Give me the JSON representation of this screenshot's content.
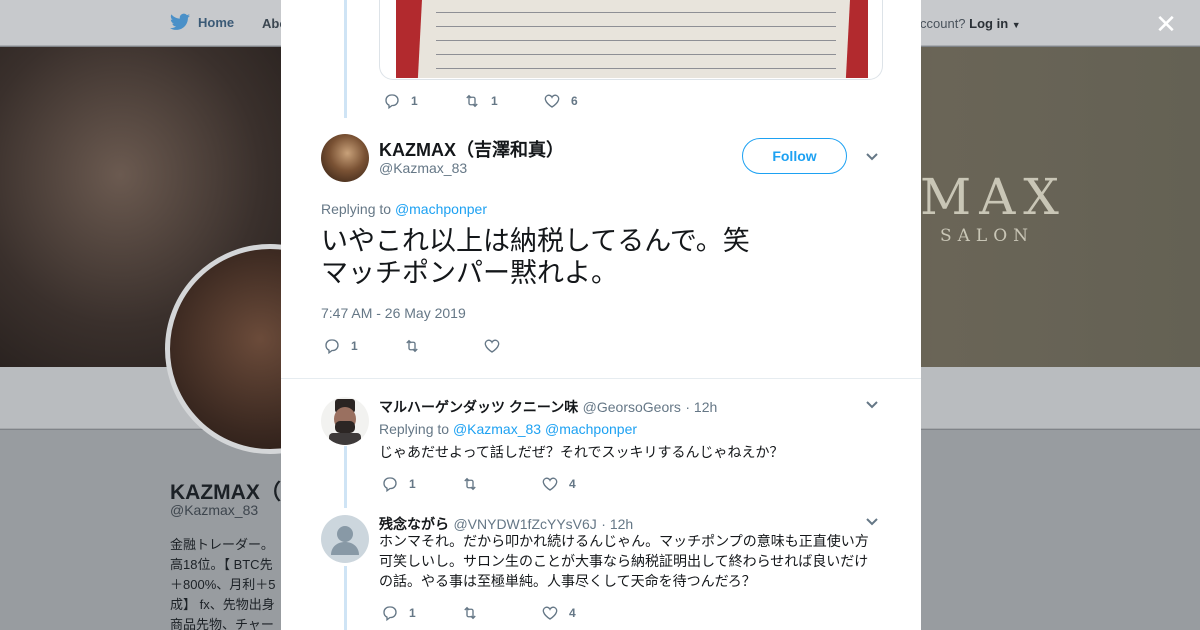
{
  "background": {
    "nav": {
      "home_label": "Home",
      "about_label": "Abo"
    },
    "login": {
      "prompt": "ccount?",
      "link": "Log in"
    },
    "banner": {
      "logo": "MAX",
      "subtitle": "SALON"
    },
    "profile": {
      "name": "KAZMAX（",
      "handle": "@Kazmax_83",
      "bio_lines": [
        "金融トレーダー。",
        "高18位。【 BTC先",
        "＋800%、月利＋5",
        "成】 fx、先物出身",
        "商品先物、チャー"
      ]
    }
  },
  "modal": {
    "previous_tweet": {
      "actions": {
        "replies": "1",
        "retweets": "1",
        "likes": "6"
      }
    },
    "main_tweet": {
      "name": "KAZMAX（吉澤和真）",
      "handle": "@Kazmax_83",
      "follow_label": "Follow",
      "replying_prefix": "Replying to",
      "replying_to": "@machponper",
      "text_line1": "いやこれ以上は納税してるんで。笑",
      "text_line2": "マッチポンパー黙れよ。",
      "timestamp": "7:47 AM - 26 May 2019",
      "actions": {
        "replies": "1",
        "retweets": "",
        "likes": ""
      }
    },
    "replies": [
      {
        "name": "マルハーゲンダッツ クニーン味",
        "handle": "@GeorsoGeors",
        "time": "· 12h",
        "replying_prefix": "Replying to",
        "replying_to_1": "@Kazmax_83",
        "replying_to_2": "@machponper",
        "text": "じゃあだせよって話しだぜ？それでスッキリするんじゃねえか？",
        "actions": {
          "replies": "1",
          "retweets": "",
          "likes": "4"
        }
      },
      {
        "name": "残念ながら",
        "handle": "@VNYDW1fZcYYsV6J",
        "time": "· 12h",
        "text_lines": [
          "ホンマそれ。だから叩かれ続けるんじゃん。マッチポンプの意味も正直使い方",
          "可笑しいし。サロン生のことが大事なら納税証明出して終わらせれば良いだけ",
          "の話。やる事は至極単純。人事尽くして天命を待つんだろ？"
        ],
        "actions": {
          "replies": "1",
          "retweets": "",
          "likes": "4"
        }
      }
    ]
  },
  "colors": {
    "accent": "#1da1f2",
    "muted": "#657786",
    "text": "#14171a",
    "thread_line": "#cfe4f5"
  }
}
